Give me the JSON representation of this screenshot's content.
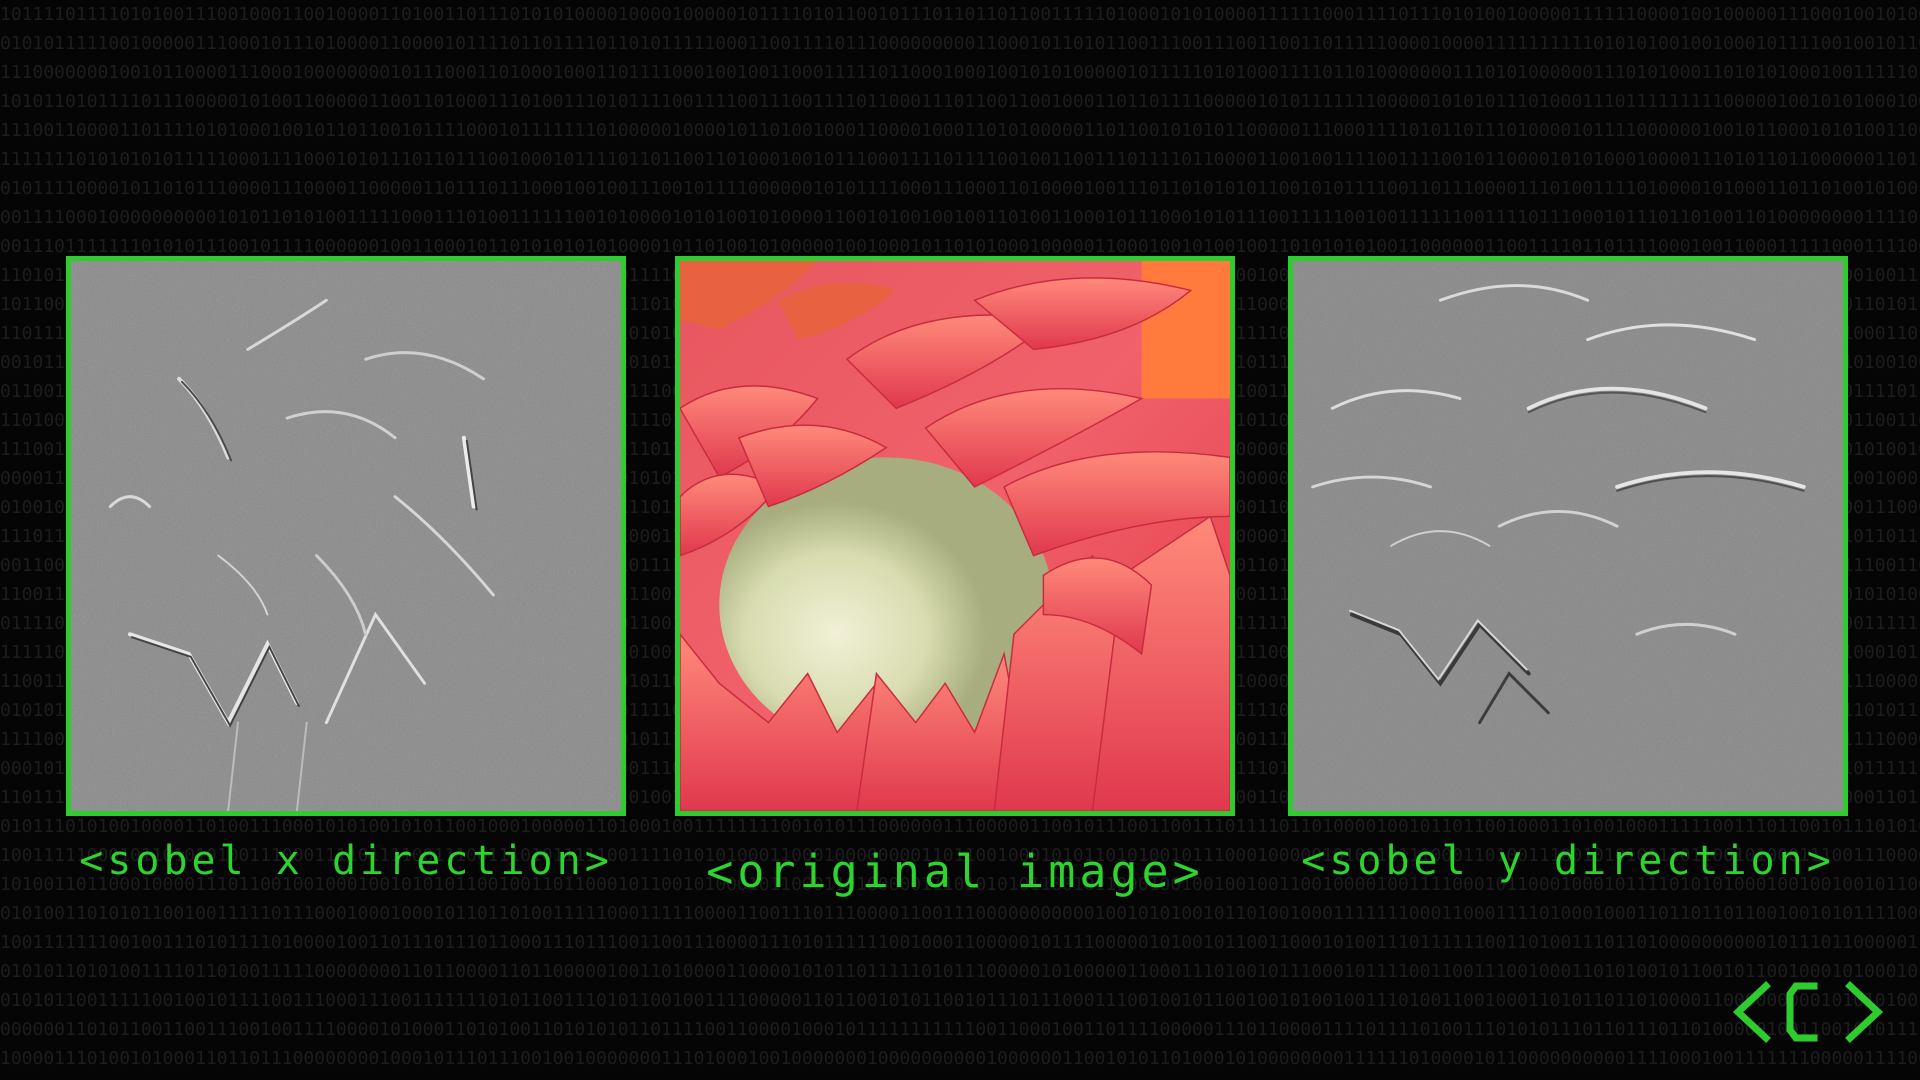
{
  "captions": {
    "sobel_x": "<sobel x direction>",
    "original": "<original image>",
    "sobel_y": "<sobel y direction>"
  },
  "colors": {
    "accent_green": "#2ecc2e",
    "background": "#050505",
    "binary_text": "#1d1d1d"
  },
  "icons": {
    "logo": "code-brackets-logo-icon"
  }
}
